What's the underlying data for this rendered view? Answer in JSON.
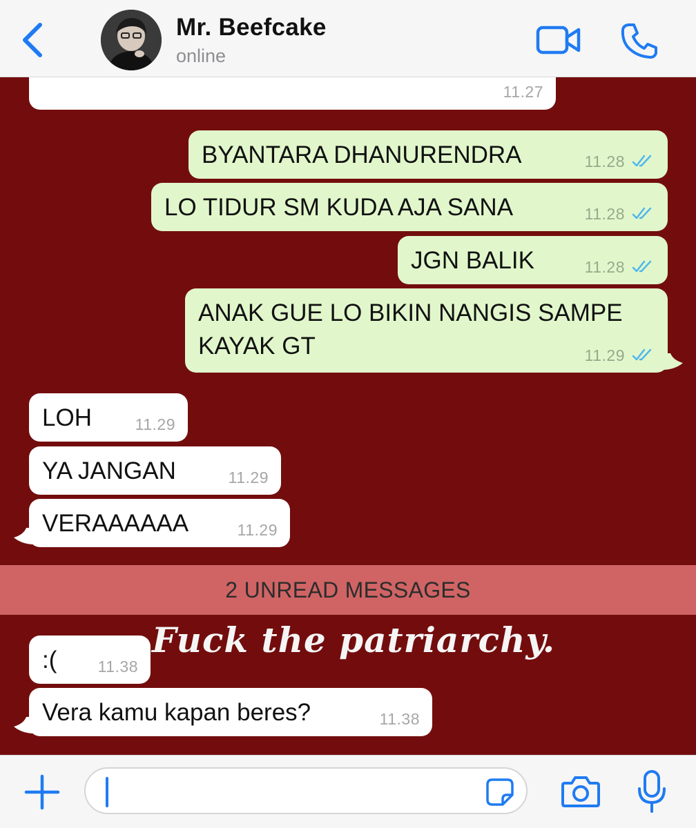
{
  "header": {
    "contact_name": "Mr. Beefcake",
    "status": "online",
    "icons": [
      "chevron-left-icon",
      "video-camera-icon",
      "phone-icon"
    ],
    "accent_color": "#1f7bf2"
  },
  "messages": [
    {
      "direction": "incoming",
      "text": "",
      "time": "11.27"
    },
    {
      "direction": "outgoing",
      "text": "BYANTARA DHANURENDRA",
      "time": "11.28",
      "status": "read"
    },
    {
      "direction": "outgoing",
      "text": "LO TIDUR SM KUDA AJA SANA",
      "time": "11.28",
      "status": "read"
    },
    {
      "direction": "outgoing",
      "text": "JGN BALIK",
      "time": "11.28",
      "status": "read"
    },
    {
      "direction": "outgoing",
      "text_line1": "ANAK GUE LO BIKIN NANGIS SAMPE",
      "text_line2": "KAYAK GT",
      "time": "11.29",
      "status": "read"
    },
    {
      "direction": "incoming",
      "text": "LOH",
      "time": "11.29"
    },
    {
      "direction": "incoming",
      "text": "YA JANGAN",
      "time": "11.29"
    },
    {
      "direction": "incoming",
      "text": "VERAAAAAA",
      "time": "11.29"
    },
    {
      "direction": "incoming",
      "text": ":(",
      "time": "11.38"
    },
    {
      "direction": "incoming",
      "text": "Vera kamu kapan beres?",
      "time": "11.38"
    }
  ],
  "unread_divider": "2 UNREAD MESSAGES",
  "wallpaper_text": "Fuck the patriarchy.",
  "composer": {
    "placeholder": "",
    "icons": [
      "plus-icon",
      "sticker-icon",
      "camera-icon",
      "microphone-icon"
    ]
  },
  "colors": {
    "wallpaper": "#730d0d",
    "incoming_bubble": "#ffffff",
    "outgoing_bubble": "#e1f7cb",
    "unread_bar": "#d06464",
    "read_tick": "#4fb6ec"
  }
}
